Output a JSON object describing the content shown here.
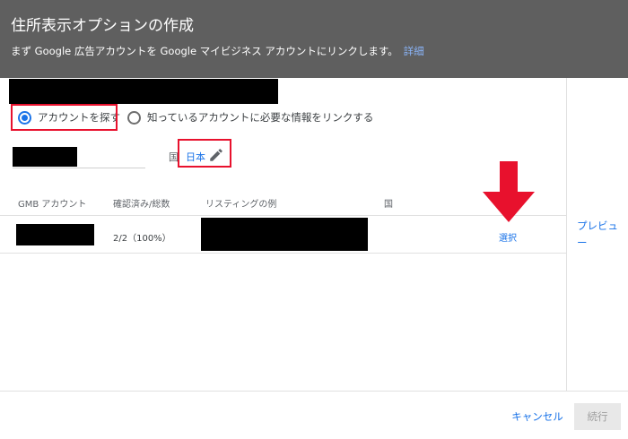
{
  "header": {
    "title": "住所表示オプションの作成",
    "subtitle": "まず Google 広告アカウントを Google マイビジネス アカウントにリンクします。",
    "details_link": "詳細"
  },
  "options": {
    "find_account": "アカウントを探す",
    "link_known_account": "知っているアカウントに必要な情報をリンクする",
    "selected": "find_account"
  },
  "filter": {
    "country_label": "国",
    "country_value": "日本"
  },
  "table": {
    "columns": [
      "GMB アカウント",
      "確認済み/総数",
      "リスティングの例",
      "国"
    ],
    "rows": [
      {
        "verified_total": "2/2（100%）",
        "action": "選択"
      }
    ]
  },
  "sidebar": {
    "preview_label": "プレビュー"
  },
  "footer": {
    "cancel": "キャンセル",
    "continue": "続行"
  },
  "colors": {
    "header_bg": "#5f5f5f",
    "accent": "#1a73e8",
    "highlight": "#e8112d"
  }
}
